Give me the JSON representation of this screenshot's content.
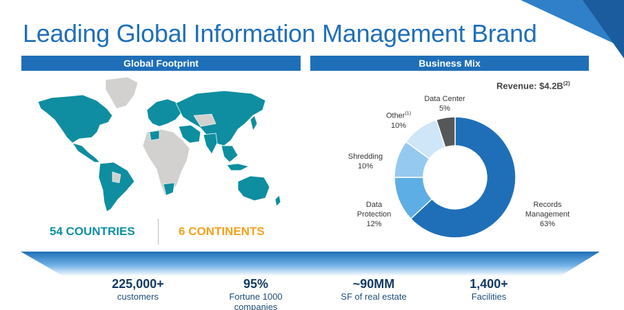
{
  "title": "Leading Global Information Management Brand",
  "sections": {
    "footprint": "Global Footprint",
    "business_mix": "Business Mix"
  },
  "footprint_stats": {
    "countries": "54 COUNTRIES",
    "continents": "6 CONTINENTS"
  },
  "revenue": {
    "text": "Revenue: $4.2B",
    "footnote": "(2)"
  },
  "chart_data": {
    "type": "pie",
    "variant": "donut",
    "slices": [
      {
        "label": "Records Management",
        "label_lines": [
          "Records",
          "Management"
        ],
        "value": 63,
        "value_text": "63%",
        "color": "#1f6fb8"
      },
      {
        "label": "Data Protection",
        "label_lines": [
          "Data",
          "Protection"
        ],
        "value": 12,
        "value_text": "12%",
        "color": "#5eaee6"
      },
      {
        "label": "Shredding",
        "label_lines": [
          "Shredding"
        ],
        "value": 10,
        "value_text": "10%",
        "color": "#95c9ef"
      },
      {
        "label": "Other",
        "label_lines": [
          "Other"
        ],
        "footnote": "(1)",
        "value": 10,
        "value_text": "10%",
        "color": "#cfe5f8"
      },
      {
        "label": "Data Center",
        "label_lines": [
          "Data Center"
        ],
        "value": 5,
        "value_text": "5%",
        "color": "#555759"
      }
    ]
  },
  "metrics": [
    {
      "value": "225,000+",
      "label": "customers"
    },
    {
      "value": "95%",
      "label": "Fortune 1000 companies"
    },
    {
      "value": "~90MM",
      "label": "SF of real estate"
    },
    {
      "value": "1,400+",
      "label": "Facilities"
    }
  ],
  "colors": {
    "brand_blue": "#1f6fb8",
    "present_country": "#0e8ea0",
    "other_country": "#d2d1cf",
    "teal_stat": "#0e8ea0",
    "orange_stat": "#f7a11a"
  }
}
